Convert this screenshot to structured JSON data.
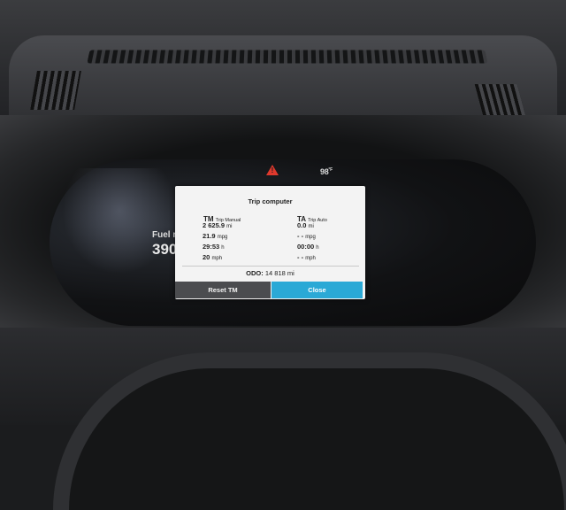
{
  "status": {
    "warning_icon": "warning-triangle-icon",
    "warning_color": "#e0392d",
    "temperature_value": "98",
    "temperature_unit": "°F"
  },
  "side_readout": {
    "label": "Fuel ra",
    "value": "390"
  },
  "dialog": {
    "title": "Trip computer",
    "trip_manual": {
      "abbr": "TM",
      "name": "Trip Manual",
      "distance": {
        "value": "2 625.9",
        "unit": "mi"
      },
      "consumption": {
        "value": "21.9",
        "unit": "mpg"
      },
      "time": {
        "value": "29:53",
        "unit": "h"
      },
      "speed": {
        "value": "20",
        "unit": "mph"
      }
    },
    "trip_auto": {
      "abbr": "TA",
      "name": "Trip Auto",
      "distance": {
        "value": "0.0",
        "unit": "mi"
      },
      "consumption": {
        "value": "- -",
        "unit": "mpg"
      },
      "time": {
        "value": "00:00",
        "unit": "h"
      },
      "speed": {
        "value": "- -",
        "unit": "mph"
      }
    },
    "odometer": {
      "label": "ODO:",
      "value": "14 818",
      "unit": "mi"
    },
    "reset_label": "Reset TM",
    "close_label": "Close",
    "close_color": "#2aa9d6"
  }
}
